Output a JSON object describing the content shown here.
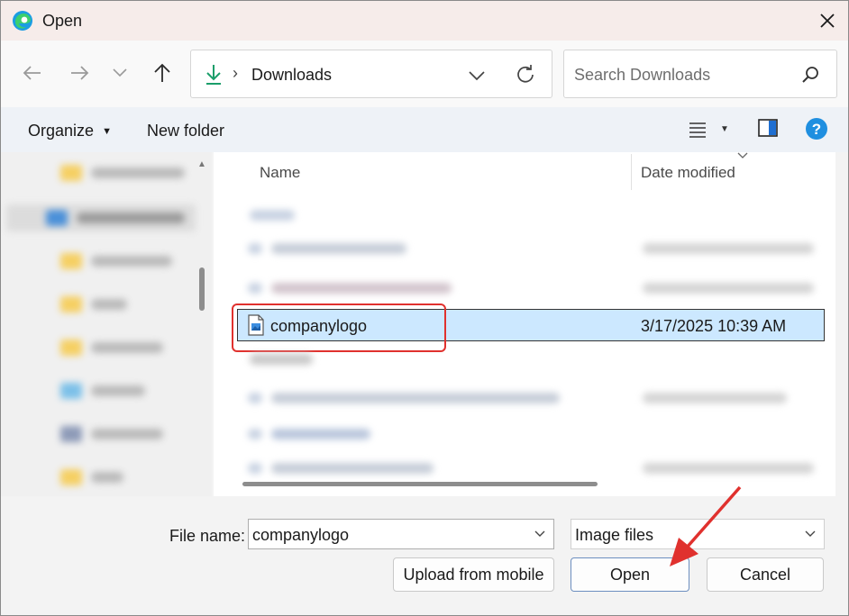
{
  "window": {
    "title": "Open",
    "close_icon": "close-icon"
  },
  "nav": {
    "address": "Downloads",
    "search_placeholder": "Search Downloads"
  },
  "toolbar": {
    "organize_label": "Organize",
    "new_folder_label": "New folder"
  },
  "file_list": {
    "columns": {
      "name": "Name",
      "date_modified": "Date modified"
    },
    "selected_file": {
      "name": "companylogo",
      "date": "3/17/2025 10:39 AM"
    }
  },
  "footer": {
    "file_name_label": "File name:",
    "file_name_value": "companylogo",
    "file_type_value": "Image files",
    "upload_label": "Upload from mobile",
    "open_label": "Open",
    "cancel_label": "Cancel"
  },
  "colors": {
    "accent": "#0067c0",
    "selection": "#cce8ff",
    "annotation_red": "#e0312e",
    "download_green": "#1a9e6a",
    "help_blue": "#1f8fe0"
  }
}
